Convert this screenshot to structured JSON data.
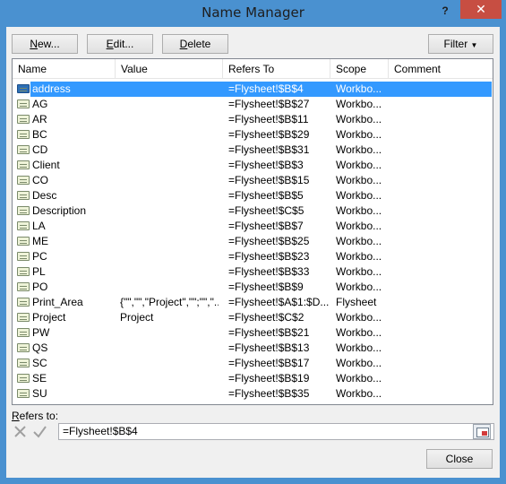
{
  "window": {
    "title": "Name Manager",
    "help": "?",
    "close": "✕"
  },
  "toolbar": {
    "new_pre": "",
    "new_u": "N",
    "new_post": "ew...",
    "edit_pre": "",
    "edit_u": "E",
    "edit_post": "dit...",
    "delete_pre": "",
    "delete_u": "D",
    "delete_post": "elete",
    "filter_label": "Filter"
  },
  "columns": [
    "Name",
    "Value",
    "Refers To",
    "Scope",
    "Comment"
  ],
  "rows": [
    {
      "name": "address",
      "value": "",
      "refers": "=Flysheet!$B$4",
      "scope": "Workbo...",
      "selected": true
    },
    {
      "name": "AG",
      "value": "",
      "refers": "=Flysheet!$B$27",
      "scope": "Workbo..."
    },
    {
      "name": "AR",
      "value": "",
      "refers": "=Flysheet!$B$11",
      "scope": "Workbo..."
    },
    {
      "name": "BC",
      "value": "",
      "refers": "=Flysheet!$B$29",
      "scope": "Workbo..."
    },
    {
      "name": "CD",
      "value": "",
      "refers": "=Flysheet!$B$31",
      "scope": "Workbo..."
    },
    {
      "name": "Client",
      "value": "",
      "refers": "=Flysheet!$B$3",
      "scope": "Workbo..."
    },
    {
      "name": "CO",
      "value": "",
      "refers": "=Flysheet!$B$15",
      "scope": "Workbo..."
    },
    {
      "name": "Desc",
      "value": "",
      "refers": "=Flysheet!$B$5",
      "scope": "Workbo..."
    },
    {
      "name": "Description",
      "value": "",
      "refers": "=Flysheet!$C$5",
      "scope": "Workbo..."
    },
    {
      "name": "LA",
      "value": "",
      "refers": "=Flysheet!$B$7",
      "scope": "Workbo..."
    },
    {
      "name": "ME",
      "value": "",
      "refers": "=Flysheet!$B$25",
      "scope": "Workbo..."
    },
    {
      "name": "PC",
      "value": "",
      "refers": "=Flysheet!$B$23",
      "scope": "Workbo..."
    },
    {
      "name": "PL",
      "value": "",
      "refers": "=Flysheet!$B$33",
      "scope": "Workbo..."
    },
    {
      "name": "PO",
      "value": "",
      "refers": "=Flysheet!$B$9",
      "scope": "Workbo..."
    },
    {
      "name": "Print_Area",
      "value": "{\"\",\"\",\"Project\",\"\";\"\",\"...",
      "refers": "=Flysheet!$A$1:$D...",
      "scope": "Flysheet"
    },
    {
      "name": "Project",
      "value": "Project",
      "refers": "=Flysheet!$C$2",
      "scope": "Workbo..."
    },
    {
      "name": "PW",
      "value": "",
      "refers": "=Flysheet!$B$21",
      "scope": "Workbo..."
    },
    {
      "name": "QS",
      "value": "",
      "refers": "=Flysheet!$B$13",
      "scope": "Workbo..."
    },
    {
      "name": "SC",
      "value": "",
      "refers": "=Flysheet!$B$17",
      "scope": "Workbo..."
    },
    {
      "name": "SE",
      "value": "",
      "refers": "=Flysheet!$B$19",
      "scope": "Workbo..."
    },
    {
      "name": "SU",
      "value": "",
      "refers": "=Flysheet!$B$35",
      "scope": "Workbo..."
    }
  ],
  "refers": {
    "label_u": "R",
    "label_post": "efers to:",
    "value": "=Flysheet!$B$4"
  },
  "footer": {
    "close_label": "Close"
  },
  "colors": {
    "title_bar": "#4a91d0",
    "selection": "#3399ff",
    "close_button": "#c74e42"
  }
}
